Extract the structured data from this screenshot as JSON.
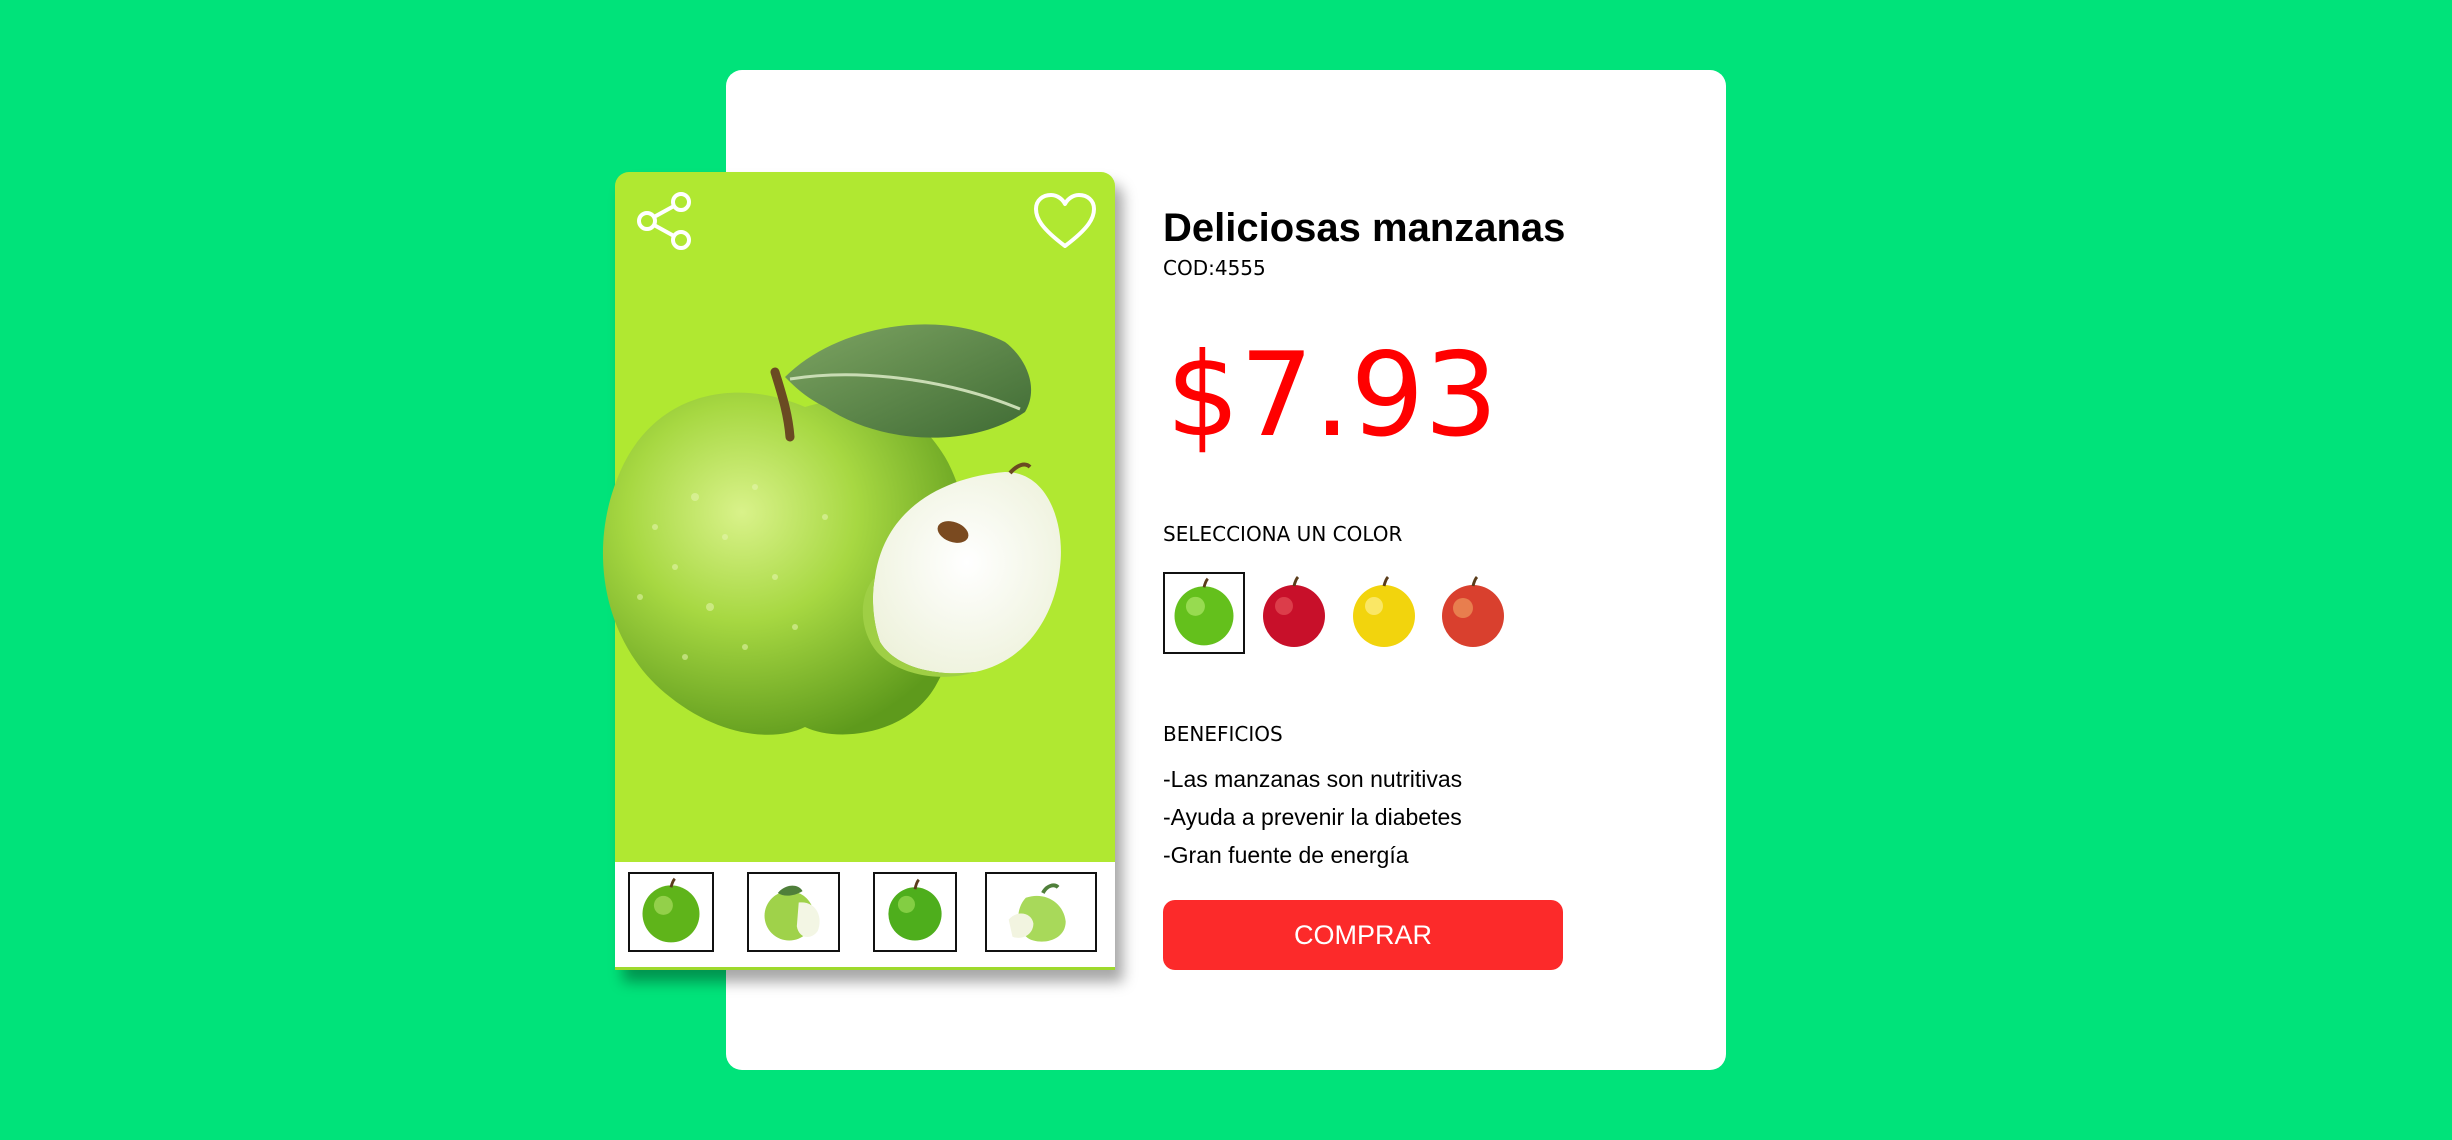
{
  "product": {
    "title": "Deliciosas manzanas",
    "code": "COD:4555",
    "price": "$7.93"
  },
  "colors": {
    "label": "SELECCIONA UN COLOR",
    "options": [
      {
        "name": "green-apple",
        "color": "#6fc21d",
        "selected": true
      },
      {
        "name": "red-apple",
        "color": "#d0142a",
        "selected": false
      },
      {
        "name": "yellow-apple",
        "color": "#f5d90e",
        "selected": false
      },
      {
        "name": "red-yellow-apple",
        "color": "#db3a2e",
        "selected": false
      }
    ]
  },
  "benefits": {
    "label": "BENEFICIOS",
    "items": [
      "-Las manzanas son nutritivas",
      "-Ayuda a prevenir la diabetes",
      "-Gran fuente de energía"
    ]
  },
  "actions": {
    "buy_label": "COMPRAR",
    "share_icon": "share-icon",
    "favorite_icon": "heart-icon"
  },
  "theme": {
    "background": "#00e37a",
    "card_background": "#b0e831",
    "price_color": "#ff0000",
    "button_color": "#fc2a2a"
  }
}
